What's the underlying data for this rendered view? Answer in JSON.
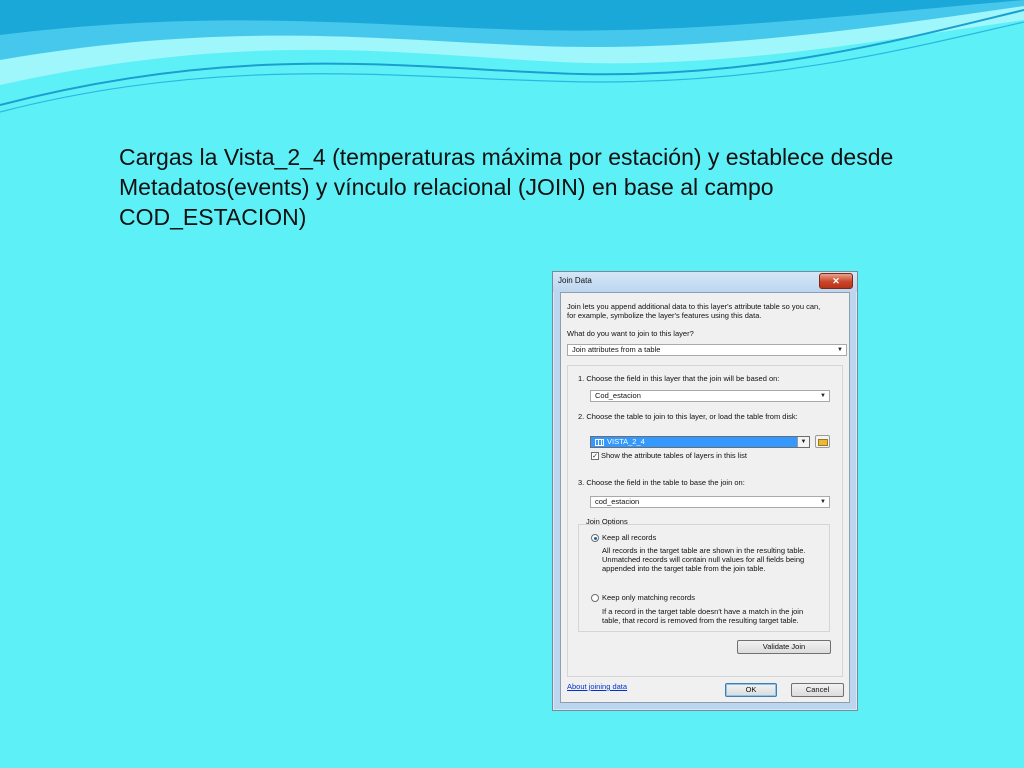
{
  "slide": {
    "text_lines": [
      "Cargas la Vista_2_4 (temperaturas máxima por estación) y establece desde",
      "Metadatos(events) y vínculo relacional (JOIN) en base al campo",
      "COD_ESTACION)"
    ]
  },
  "dialog": {
    "title": "Join Data",
    "close_glyph": "✕",
    "intro_line1": "Join lets you append additional data to this layer's attribute table so you can,",
    "intro_line2": "for example, symbolize the layer's features using this data.",
    "question": "What do you want to join to this layer?",
    "join_type": "Join attributes from a table",
    "step1_label": "1.  Choose the field in this layer that the join will be based on:",
    "step1_value": "Cod_estacion",
    "step2_label": "2.  Choose the table to join to this layer, or load the table from disk:",
    "step2_value": "VISTA_2_4",
    "show_tables_label": "Show the attribute tables of layers in this list",
    "show_tables_checked": true,
    "step3_label": "3.  Choose the field in the table to base the join on:",
    "step3_value": "cod_estacion",
    "join_options_title": "Join Options",
    "keep_all_label": "Keep all records",
    "keep_all_desc1": "All records in the target table are shown in the resulting table.",
    "keep_all_desc2": "Unmatched records will contain null values for all fields being",
    "keep_all_desc3": "appended into the target table from the join table.",
    "keep_matching_label": "Keep only matching records",
    "keep_matching_desc1": "If a record in the target table doesn't have a match in the join",
    "keep_matching_desc2": "table, that record is removed from the resulting target table.",
    "selected_option": "Keep all records",
    "validate_label": "Validate Join",
    "about_link": "About joining data",
    "ok_label": "OK",
    "cancel_label": "Cancel"
  },
  "colors": {
    "background": "#5ef0f7",
    "wave_dark": "#1aa8d8",
    "selection": "#3399ff"
  }
}
